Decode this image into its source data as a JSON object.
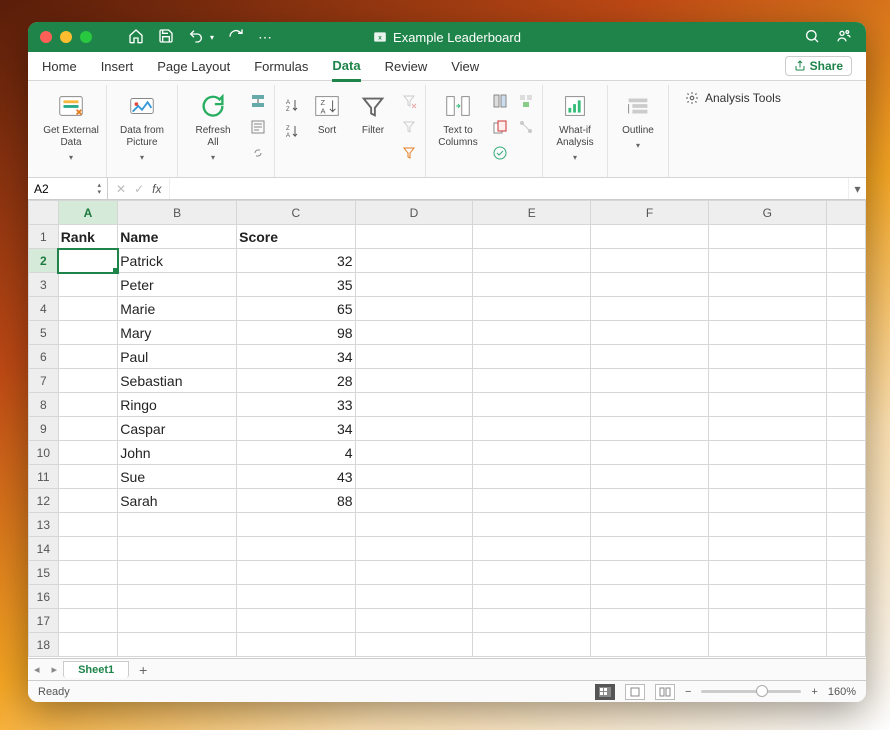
{
  "titlebar": {
    "title": "Example Leaderboard"
  },
  "tabs": {
    "items": [
      "Home",
      "Insert",
      "Page Layout",
      "Formulas",
      "Data",
      "Review",
      "View"
    ],
    "active": "Data",
    "share": "Share"
  },
  "ribbon": {
    "getExternalData": "Get External\nData",
    "dataFromPicture": "Data from\nPicture",
    "refreshAll": "Refresh\nAll",
    "sort": "Sort",
    "filter": "Filter",
    "textToColumns": "Text to\nColumns",
    "whatIf": "What-if\nAnalysis",
    "outline": "Outline",
    "analysisTools": "Analysis Tools"
  },
  "formulaBar": {
    "nameBox": "A2",
    "formula": ""
  },
  "grid": {
    "columns": [
      "A",
      "B",
      "C",
      "D",
      "E",
      "F",
      "G"
    ],
    "selectedCol": "A",
    "selectedRow": 2,
    "rowCount": 18,
    "headers": {
      "A": "Rank",
      "B": "Name",
      "C": "Score"
    },
    "data": [
      {
        "row": 2,
        "B": "Patrick",
        "C": 32
      },
      {
        "row": 3,
        "B": "Peter",
        "C": 35
      },
      {
        "row": 4,
        "B": "Marie",
        "C": 65
      },
      {
        "row": 5,
        "B": "Mary",
        "C": 98
      },
      {
        "row": 6,
        "B": "Paul",
        "C": 34
      },
      {
        "row": 7,
        "B": "Sebastian",
        "C": 28
      },
      {
        "row": 8,
        "B": "Ringo",
        "C": 33
      },
      {
        "row": 9,
        "B": "Caspar",
        "C": 34
      },
      {
        "row": 10,
        "B": "John",
        "C": 4
      },
      {
        "row": 11,
        "B": "Sue",
        "C": 43
      },
      {
        "row": 12,
        "B": "Sarah",
        "C": 88
      }
    ]
  },
  "sheetTabs": {
    "tabs": [
      "Sheet1"
    ],
    "active": "Sheet1"
  },
  "status": {
    "text": "Ready",
    "zoom": "160%"
  }
}
